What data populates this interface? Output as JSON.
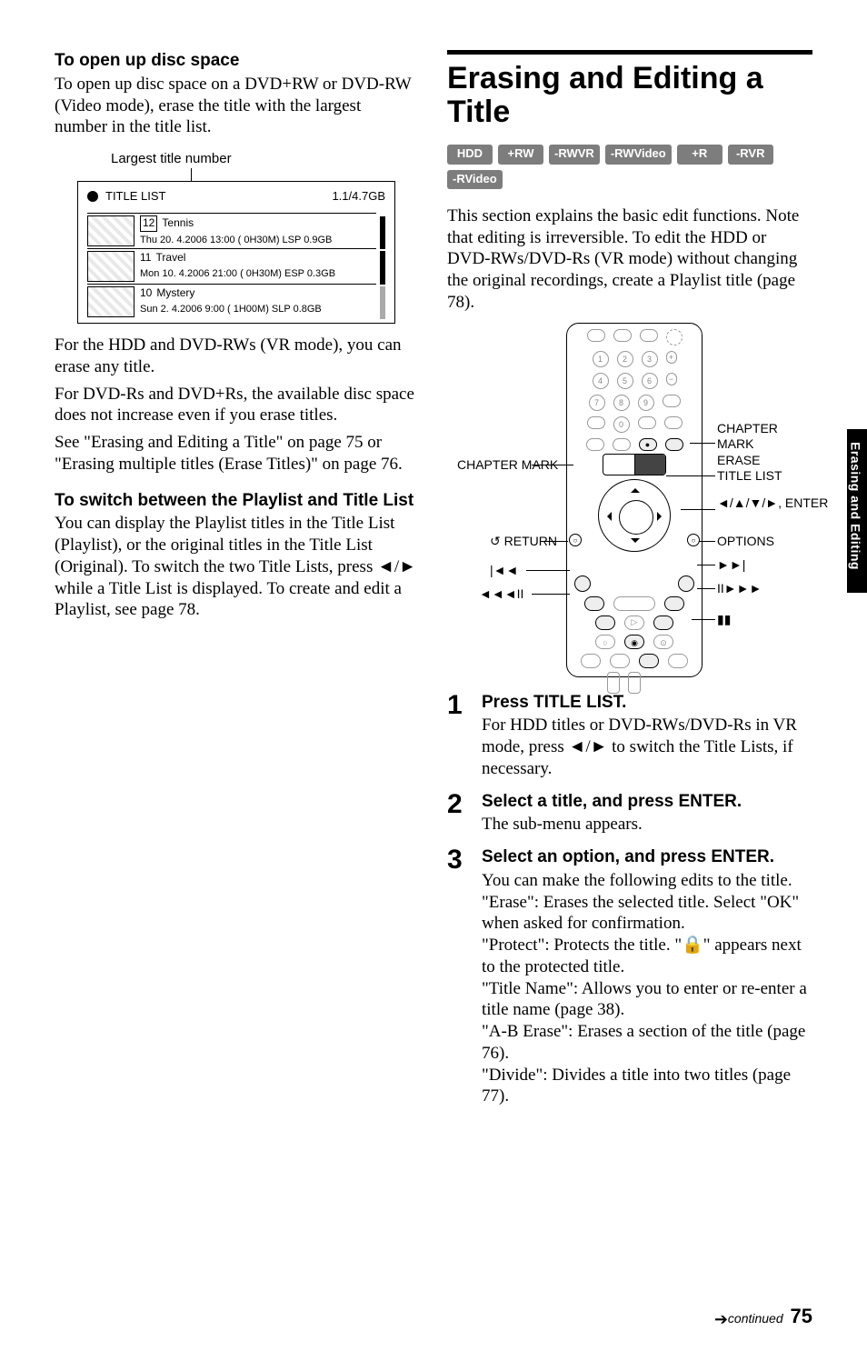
{
  "sidetab": "Erasing and Editing",
  "left": {
    "h2a": "To open up disc space",
    "p1": "To open up disc space on a DVD+RW or DVD-RW (Video mode), erase the title with the largest number in the title list.",
    "figcap": "Largest title number",
    "tlist": {
      "head_left": "TITLE LIST",
      "head_right": "1.1/4.7GB",
      "rows": [
        {
          "num": "12",
          "boxed": true,
          "title": "Tennis",
          "line2": "Thu  20. 4.2006   13:00 ( 0H30M) LSP 0.9GB"
        },
        {
          "num": "11",
          "boxed": false,
          "title": "Travel",
          "line2": "Mon 10. 4.2006   21:00 ( 0H30M) ESP 0.3GB"
        },
        {
          "num": "10",
          "boxed": false,
          "title": "Mystery",
          "line2": "Sun    2. 4.2006     9:00 ( 1H00M) SLP 0.8GB"
        }
      ]
    },
    "p2": "For the HDD and DVD-RWs (VR mode), you can erase any title.",
    "p3": "For DVD-Rs and DVD+Rs, the available disc space does not increase even if you erase titles.",
    "p4": "See \"Erasing and Editing a Title\" on page 75 or \"Erasing multiple titles (Erase Titles)\" on page 76.",
    "h2b": "To switch between the Playlist and Title List",
    "p5": "You can display the Playlist titles in the Title List (Playlist), or the original titles in the Title List (Original). To switch the two Title Lists, press ◄/► while a Title List is displayed. To create and edit a Playlist, see page 78."
  },
  "right": {
    "h1": "Erasing and Editing a Title",
    "badges": [
      "HDD",
      "+RW",
      "-RWVR",
      "-RWVideo",
      "+R",
      "-RVR",
      "-RVideo"
    ],
    "intro": "This section explains the basic edit functions. Note that editing is irreversible. To edit the HDD or DVD-RWs/DVD-Rs (VR mode) without changing the original recordings, create a Playlist title (page 78).",
    "labels": {
      "chap_mark_left": "CHAPTER MARK",
      "return": "↺ RETURN",
      "prev": "|◄◄",
      "rew": "◄◄◄II",
      "chap_mark_erase": "CHAPTER MARK ERASE",
      "title_list": "TITLE LIST",
      "arrows_enter": "◄/▲/▼/►, ENTER",
      "options": "OPTIONS",
      "next": "►►|",
      "ff": "II►►►",
      "pause": "▮▮"
    },
    "steps": [
      {
        "n": "1",
        "h": "Press TITLE LIST.",
        "body": "For HDD titles or DVD-RWs/DVD-Rs in VR mode, press ◄/► to switch the Title Lists, if necessary."
      },
      {
        "n": "2",
        "h": "Select a title, and press ENTER.",
        "body": "The sub-menu appears."
      },
      {
        "n": "3",
        "h": "Select an option, and press ENTER.",
        "body": "You can make the following edits to the title.\n\"Erase\": Erases the selected title. Select \"OK\" when asked for confirmation.\n\"Protect\": Protects the title. \"🔒\" appears next to the protected title.\n\"Title Name\": Allows you to enter or re-enter a title name (page 38).\n\"A-B Erase\": Erases a section of the title (page 76).\n\"Divide\": Divides a title into two titles (page 77)."
      }
    ]
  },
  "footer": {
    "arrow": "➔",
    "text": "continued",
    "page": "75"
  }
}
